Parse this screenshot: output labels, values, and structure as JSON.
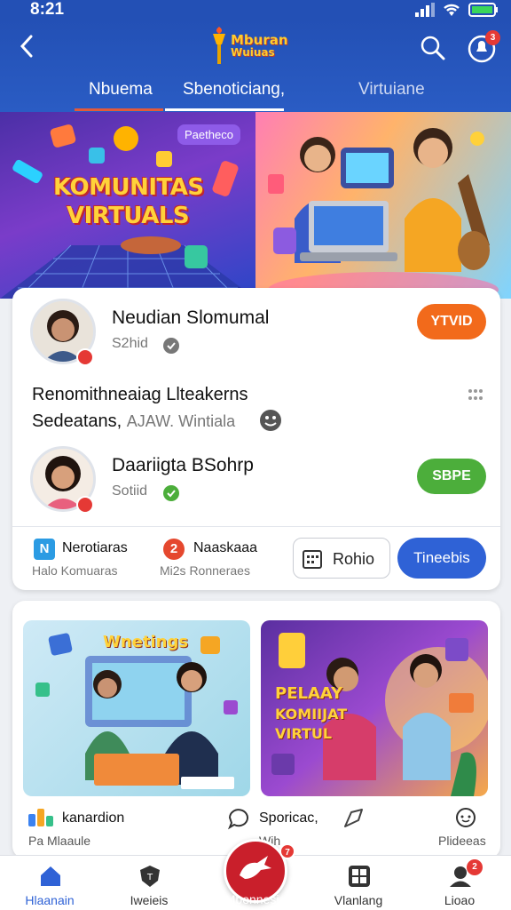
{
  "status": {
    "time": "8:21"
  },
  "header": {
    "logo_line1": "Mburan",
    "logo_line2": "Wuiuas",
    "notification_count": "3",
    "tabs": [
      {
        "label": "Nbuema",
        "active": true
      },
      {
        "label": "Sbenoticiang,",
        "active": false
      },
      {
        "label": "Virtuiane",
        "active": false
      }
    ]
  },
  "hero": {
    "badge": "Paetheco",
    "title_line1": "KOMUNITAS",
    "title_line2": "VIRTUALS"
  },
  "feed": {
    "user1": {
      "name": "Neudian Slomumal",
      "sub": "S2hid",
      "pill": "YTVID"
    },
    "post": {
      "line1": "Renomithneaiag Llteakerns",
      "line2_main": "Sedeatans,",
      "line2_muted": "AJAW. Wintiala"
    },
    "user2": {
      "name": "Daariigta BSohrp",
      "sub": "Sotiid",
      "pill": "SBPE"
    },
    "stats": [
      {
        "label": "Nerotiaras",
        "sub": "Halo Komuaras"
      },
      {
        "label": "Naaskaaa",
        "sub": "Mi2s Ronneraes"
      }
    ],
    "button_outline": "Rohio",
    "button_primary": "Tineebis"
  },
  "grid": {
    "left_title": "Wnetings",
    "right_title_line1": "PELAAY",
    "right_title_line2": "KOMIIJAT",
    "right_title_line3": "VIRTUL",
    "actions": [
      {
        "label": "kanardion",
        "sub": "Pa Mlaaule"
      },
      {
        "label": "Sporicac,",
        "sub": "Wih"
      },
      {
        "label": "",
        "sub": "Plideeas"
      }
    ]
  },
  "bottom_nav": {
    "items": [
      {
        "label": "Hlaanain",
        "icon": "home-icon"
      },
      {
        "label": "Iweieis",
        "icon": "shield-icon"
      },
      {
        "label": "Mbonnesia",
        "icon": "dragon-icon",
        "badge": "7"
      },
      {
        "label": "Vlanlang",
        "icon": "grid-icon"
      },
      {
        "label": "Lioao",
        "icon": "profile-icon",
        "badge": "2"
      }
    ]
  },
  "colors": {
    "brand_blue": "#2350b5",
    "accent_red": "#c91f2b",
    "orange": "#f26a1b",
    "green": "#4cae3b"
  }
}
